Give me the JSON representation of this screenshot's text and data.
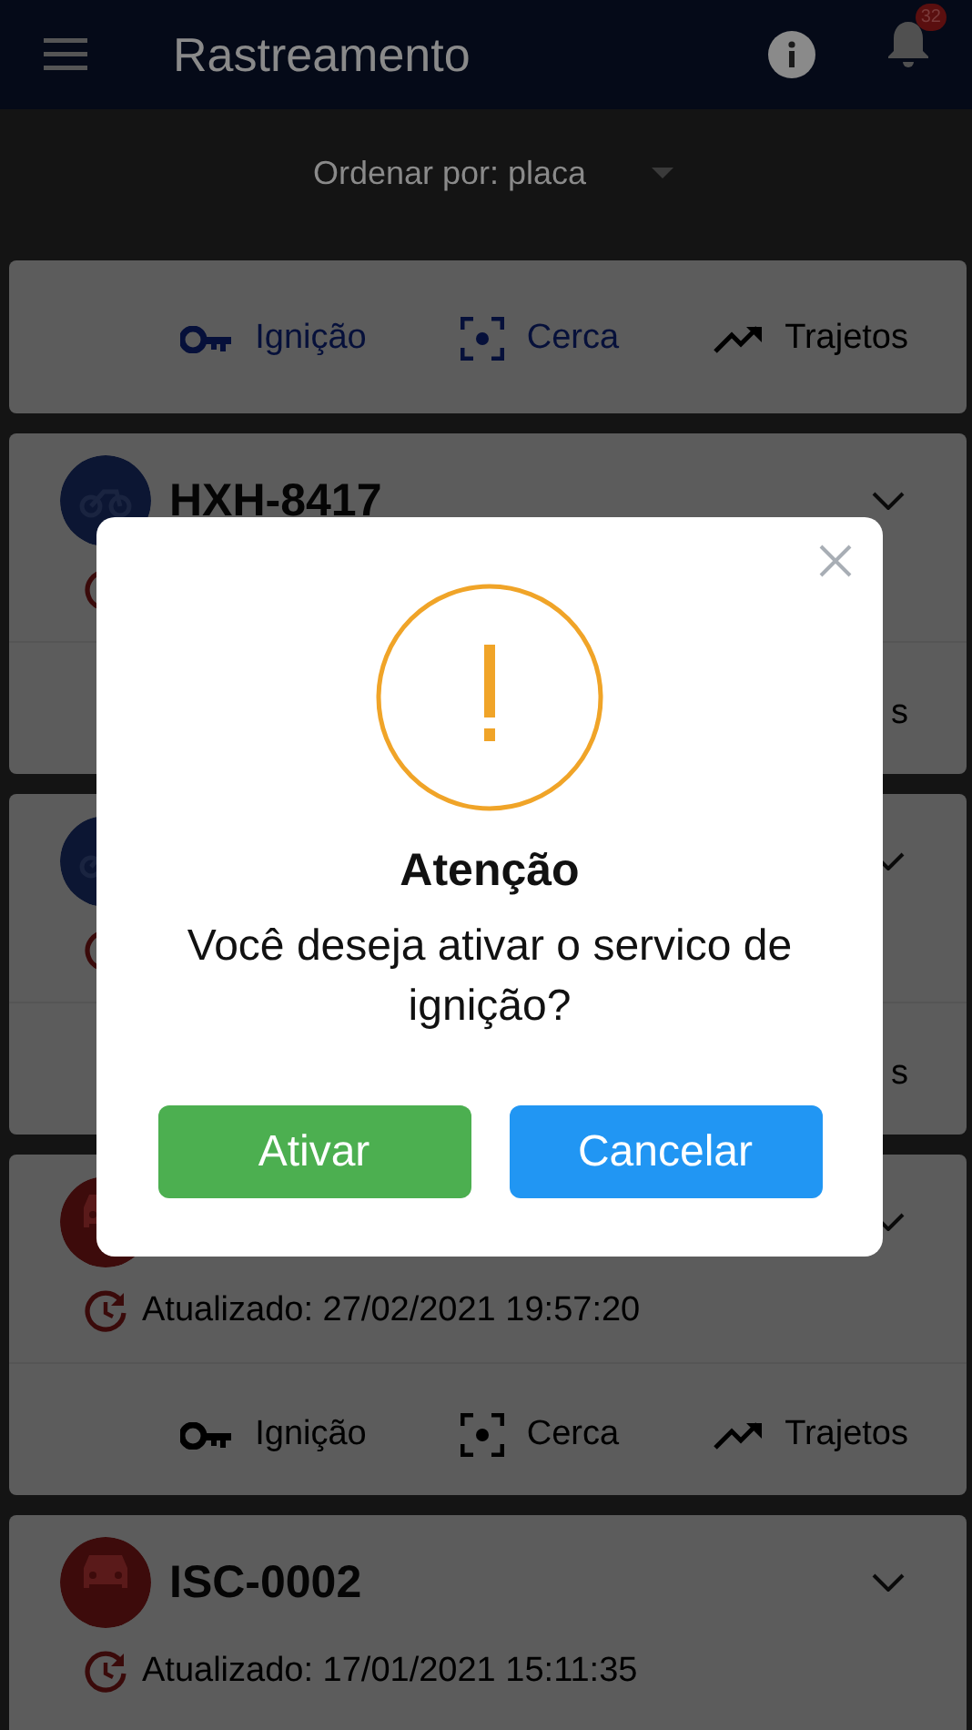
{
  "app_bar": {
    "title": "Rastreamento",
    "notification_count": "32"
  },
  "sort": {
    "label": "Ordenar por: placa"
  },
  "cards": [
    {
      "kind": "actions",
      "actions": [
        {
          "label": "Ignição",
          "active": true
        },
        {
          "label": "Cerca",
          "active": true
        },
        {
          "label": "Trajetos",
          "active": false
        }
      ]
    },
    {
      "kind": "motorcycle",
      "color": "#0c1633",
      "plate": "HXH-8417",
      "fragment": "s"
    },
    {
      "kind": "motorcycle",
      "color": "#0c1633",
      "fragment": "s"
    },
    {
      "kind": "car",
      "color": "#3d0b0b",
      "updated": "Atualizado: 27/02/2021 19:57:20",
      "actions": [
        {
          "label": "Ignição",
          "active": false
        },
        {
          "label": "Cerca",
          "active": false
        },
        {
          "label": "Trajetos",
          "active": false
        }
      ]
    },
    {
      "kind": "car",
      "color": "#3d0b0b",
      "plate": "ISC-0002",
      "updated": "Atualizado: 17/01/2021 15:11:35"
    }
  ],
  "dialog": {
    "title": "Atenção",
    "message": "Você deseja ativar o servico de ignição?",
    "buttons": [
      {
        "label": "Ativar",
        "kind": "confirm"
      },
      {
        "label": "Cancelar",
        "kind": "cancel"
      }
    ]
  }
}
